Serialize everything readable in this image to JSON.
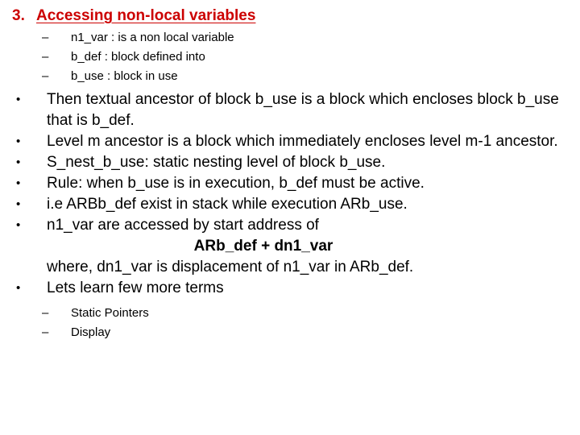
{
  "slide": {
    "background_color": "#ffffff",
    "heading": {
      "number": "3.",
      "title": "Accessing non-local variables",
      "color": "#CC0000"
    },
    "definitions": [
      {
        "mark": "–",
        "text": "n1_var : is a non local variable"
      },
      {
        "mark": "–",
        "text": "b_def : block defined into"
      },
      {
        "mark": "–",
        "text": "b_use : block in use"
      }
    ],
    "bullets": [
      {
        "mark": "•",
        "text": "Then textual ancestor of block b_use is a block which encloses block b_use that is b_def."
      },
      {
        "mark": "•",
        "text": "Level m ancestor is a block which immediately encloses level m-1 ancestor."
      },
      {
        "mark": "•",
        "text": "S_nest_b_use: static nesting level of block b_use."
      },
      {
        "mark": "•",
        "text": "Rule: when b_use is in execution, b_def must be active."
      },
      {
        "mark": "•",
        "text": "i.e ARBb_def exist in stack while execution ARb_use."
      },
      {
        "mark": "•",
        "text": "n1_var are accessed by start address of"
      }
    ],
    "formula": "ARb_def + dn1_var",
    "formula_note": "where, dn1_var is displacement of n1_var in ARb_def.",
    "last_bullet": {
      "mark": "•",
      "text": "Lets learn few more terms"
    },
    "terms": [
      {
        "mark": "–",
        "text": "Static Pointers"
      },
      {
        "mark": "–",
        "text": "Display"
      }
    ]
  }
}
